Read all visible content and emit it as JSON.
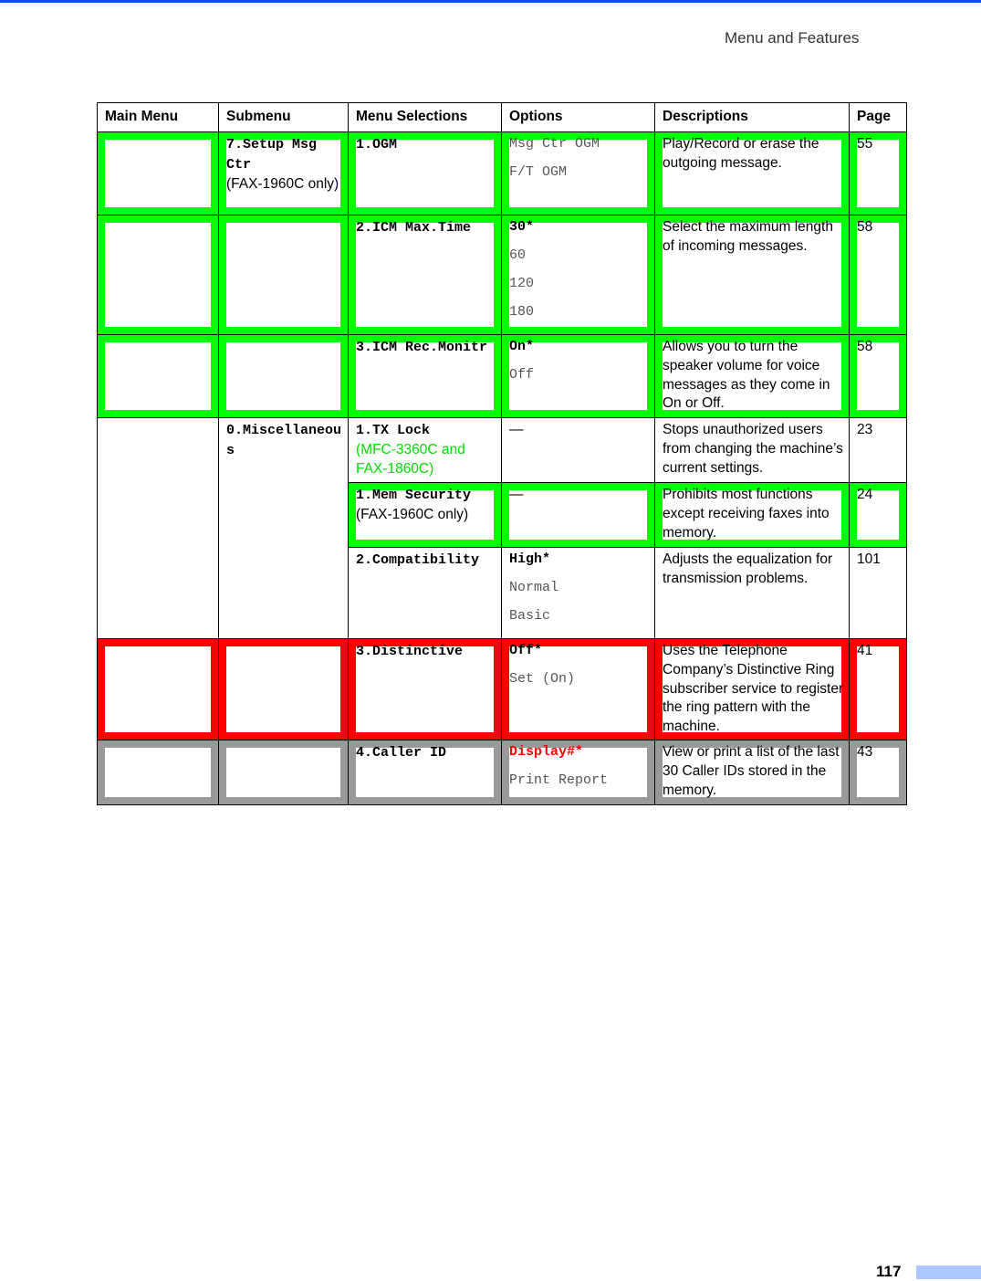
{
  "header": {
    "running_title": "Menu and Features"
  },
  "footer": {
    "page_number": "117"
  },
  "colors": {
    "highlight_green": "#00ff00",
    "highlight_red": "#ff0000",
    "highlight_gray": "#999999",
    "top_rule": "#0050f0",
    "page_tab": "#aec8ff"
  },
  "table": {
    "columns": [
      "Main Menu",
      "Submenu",
      "Menu Selections",
      "Options",
      "Descriptions",
      "Page"
    ],
    "rows": [
      {
        "main_menu": "",
        "submenu_code": "7.Setup Msg Ctr",
        "submenu_note": "(FAX-1960C only)",
        "selection_code": "1.OGM",
        "selection_note": "",
        "options": [
          {
            "text": "Msg Ctr OGM",
            "default": false
          },
          {
            "text": "F/T OGM",
            "default": false
          }
        ],
        "description": "Play/Record or erase the outgoing message.",
        "page": "55",
        "highlight": "green"
      },
      {
        "main_menu": "",
        "submenu_code": "",
        "submenu_note": "",
        "selection_code": "2.ICM Max.Time",
        "selection_note": "",
        "options": [
          {
            "text": "30*",
            "default": true
          },
          {
            "text": "60",
            "default": false
          },
          {
            "text": "120",
            "default": false
          },
          {
            "text": "180",
            "default": false
          }
        ],
        "description": "Select the maximum length of incoming messages.",
        "page": "58",
        "highlight": "green"
      },
      {
        "main_menu": "",
        "submenu_code": "",
        "submenu_note": "",
        "selection_code": "3.ICM Rec.Monitr",
        "selection_note": "",
        "options": [
          {
            "text": "On*",
            "default": true
          },
          {
            "text": "Off",
            "default": false
          }
        ],
        "description": "Allows you to turn the speaker volume for voice messages as they come in On or Off.",
        "page": "58",
        "highlight": "green"
      },
      {
        "main_menu": "",
        "submenu_code": "0.Miscellaneous",
        "submenu_note": "",
        "selection_code": "1.TX Lock",
        "selection_note": "(MFC-3360C and FAX-1860C)",
        "options": [
          {
            "text": "—",
            "default": false
          }
        ],
        "description": "Stops unauthorized users from changing the machine’s current settings.",
        "page": "23",
        "highlight": "none"
      },
      {
        "main_menu": "",
        "submenu_code": "",
        "submenu_note": "",
        "selection_code": "1.Mem Security",
        "selection_note": "(FAX-1960C only)",
        "options": [
          {
            "text": "—",
            "default": false
          }
        ],
        "description": "Prohibits most functions except receiving faxes into memory.",
        "page": "24",
        "highlight": "green"
      },
      {
        "main_menu": "",
        "submenu_code": "",
        "submenu_note": "",
        "selection_code": "2.Compatibility",
        "selection_note": "",
        "options": [
          {
            "text": "High*",
            "default": true
          },
          {
            "text": "Normal",
            "default": false
          },
          {
            "text": "Basic",
            "default": false
          }
        ],
        "description": "Adjusts the equalization for transmission problems.",
        "page": "101",
        "highlight": "none"
      },
      {
        "main_menu": "",
        "submenu_code": "",
        "submenu_note": "",
        "selection_code": "3.Distinctive",
        "selection_note": "",
        "options": [
          {
            "text": "Off*",
            "default": true
          },
          {
            "text": "Set (On)",
            "default": false
          }
        ],
        "description": "Uses the Telephone Company’s Distinctive Ring subscriber service to register the ring pattern with the machine.",
        "page": "41",
        "highlight": "red"
      },
      {
        "main_menu": "",
        "submenu_code": "",
        "submenu_note": "",
        "selection_code": "4.Caller ID",
        "selection_note": "",
        "options": [
          {
            "text": "Display#*",
            "default": true,
            "red": true
          },
          {
            "text": "Print Report",
            "default": false
          }
        ],
        "description": "View or print a list of the last 30 Caller IDs stored in the memory.",
        "page": "43",
        "highlight": "gray"
      }
    ]
  }
}
